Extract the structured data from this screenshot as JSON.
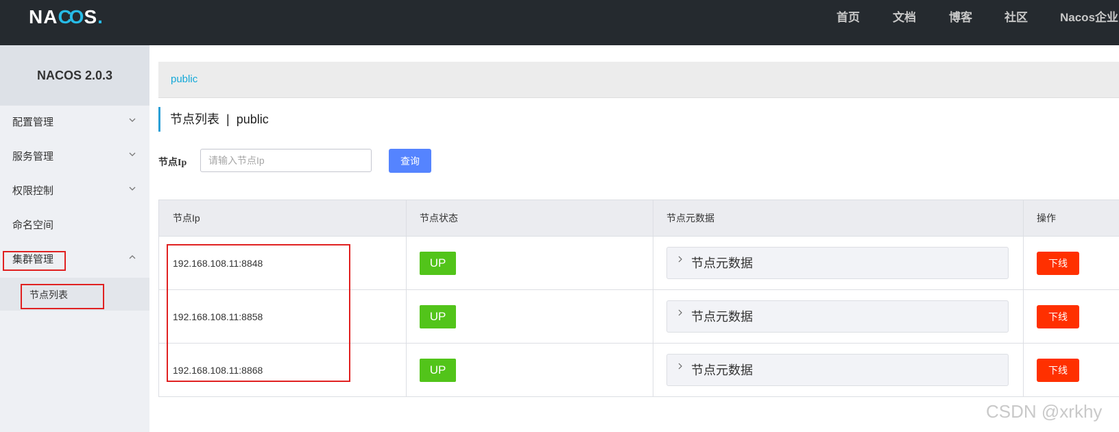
{
  "header": {
    "logo_text": "NA",
    "logo_oo": "CO",
    "logo_tail": "S",
    "logo_dot": ".",
    "nav": [
      "首页",
      "文档",
      "博客",
      "社区",
      "Nacos企业"
    ]
  },
  "sidebar": {
    "version": "NACOS 2.0.3",
    "items": [
      {
        "label": "配置管理",
        "icon": "chevron-down-icon"
      },
      {
        "label": "服务管理",
        "icon": "chevron-down-icon"
      },
      {
        "label": "权限控制",
        "icon": "chevron-down-icon"
      },
      {
        "label": "命名空间",
        "icon": ""
      },
      {
        "label": "集群管理",
        "icon": "chevron-up-icon"
      }
    ],
    "subitem": "节点列表"
  },
  "breadcrumb": "public",
  "page": {
    "title": "节点列表",
    "separator": "|",
    "namespace": "public"
  },
  "filter": {
    "label": "节点Ip",
    "placeholder": "请输入节点Ip",
    "value": "",
    "query_button": "查询"
  },
  "table": {
    "columns": [
      "节点Ip",
      "节点状态",
      "节点元数据",
      "操作"
    ],
    "rows": [
      {
        "ip": "192.168.108.11:8848",
        "status": "UP",
        "metadata": "节点元数据",
        "action": "下线"
      },
      {
        "ip": "192.168.108.11:8858",
        "status": "UP",
        "metadata": "节点元数据",
        "action": "下线"
      },
      {
        "ip": "192.168.108.11:8868",
        "status": "UP",
        "metadata": "节点元数据",
        "action": "下线"
      }
    ]
  },
  "colors": {
    "header_bg": "#252a2f",
    "accent": "#13a8d8",
    "status_up": "#52c41a",
    "offline": "#ff3000",
    "query_button": "#5584ff",
    "highlight": "#e02020"
  },
  "watermark": "CSDN @xrkhy"
}
